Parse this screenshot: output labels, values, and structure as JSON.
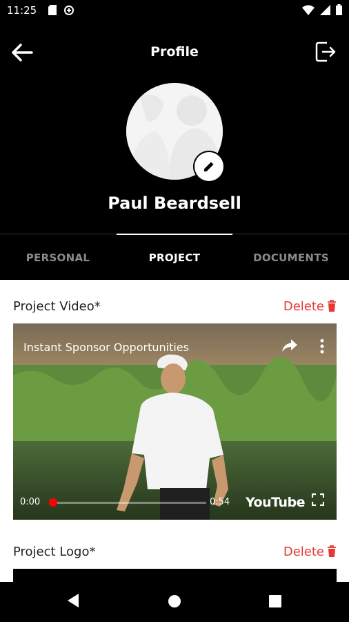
{
  "status_bar": {
    "time": "11:25"
  },
  "header": {
    "title": "Profile",
    "user_name": "Paul Beardsell"
  },
  "tabs": [
    {
      "label": "PERSONAL",
      "active": false
    },
    {
      "label": "PROJECT",
      "active": true
    },
    {
      "label": "DOCUMENTS",
      "active": false
    }
  ],
  "project_video": {
    "label": "Project Video*",
    "delete_label": "Delete",
    "video": {
      "title": "Instant Sponsor Opportunities",
      "current_time": "0:00",
      "duration": "0:54",
      "brand": "YouTube",
      "progress": 0
    }
  },
  "project_logo": {
    "label": "Project Logo*",
    "delete_label": "Delete"
  },
  "colors": {
    "accent_red": "#e53935",
    "header_bg": "#000000"
  },
  "icons": [
    "back-arrow-icon",
    "logout-icon",
    "pencil-icon",
    "trash-icon",
    "share-icon",
    "more-vertical-icon",
    "fullscreen-icon",
    "nav-back-icon",
    "nav-home-icon",
    "nav-recents-icon"
  ]
}
